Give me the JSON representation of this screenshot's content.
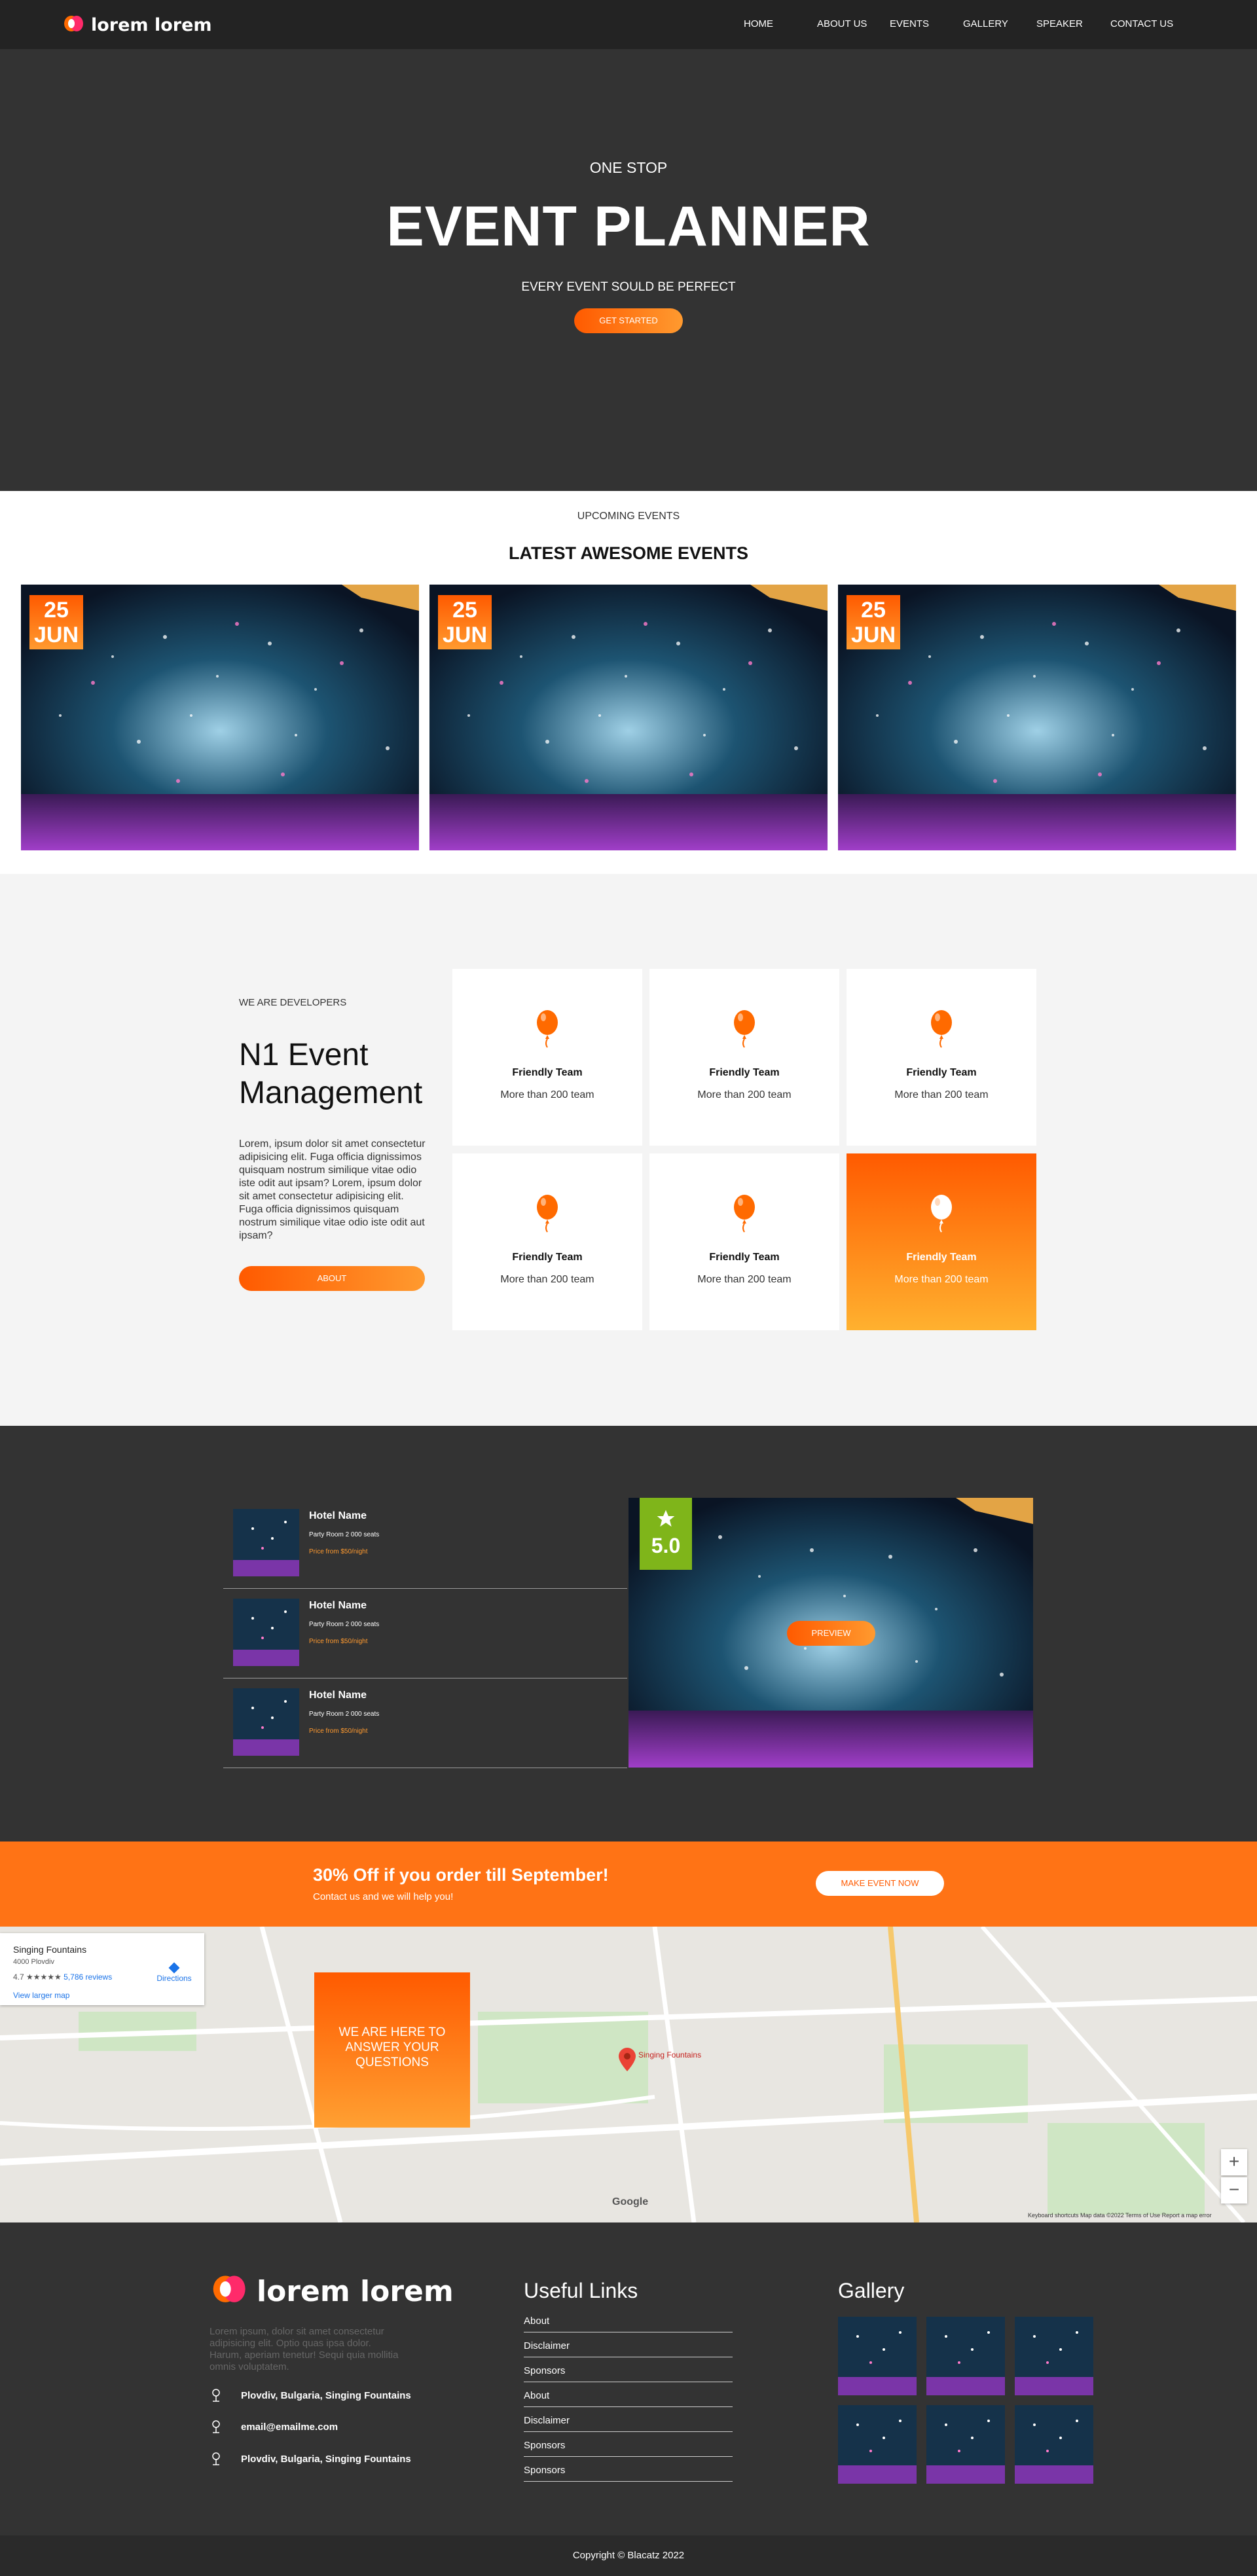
{
  "brand": {
    "name": "lorem lorem"
  },
  "nav": {
    "items": [
      "HOME",
      "ABOUT US",
      "EVENTS",
      "GALLERY",
      "SPEAKER",
      "CONTACT US"
    ]
  },
  "hero": {
    "kicker": "ONE STOP",
    "title": "EVENT PLANNER",
    "subtitle": "EVERY EVENT SOULD BE PERFECT",
    "cta": "GET STARTED"
  },
  "upcoming": {
    "kicker": "UPCOMING EVENTS",
    "title": "LATEST AWESOME EVENTS",
    "events": [
      {
        "day": "25",
        "month": "JUN"
      },
      {
        "day": "25",
        "month": "JUN"
      },
      {
        "day": "25",
        "month": "JUN"
      }
    ]
  },
  "developers": {
    "kicker": "WE ARE DEVELOPERS",
    "title": "N1 Event Management",
    "text": "Lorem, ipsum dolor sit amet consectetur adipisicing elit. Fuga officia dignissimos quisquam nostrum similique vitae odio iste odit aut ipsam? Lorem, ipsum dolor sit amet consectetur adipisicing elit. Fuga officia dignissimos quisquam nostrum similique vitae odio iste odit aut ipsam?",
    "button": "ABOUT",
    "features": [
      {
        "title": "Friendly Team",
        "subtitle": "More than 200 team"
      },
      {
        "title": "Friendly Team",
        "subtitle": "More than 200 team"
      },
      {
        "title": "Friendly Team",
        "subtitle": "More than 200 team"
      },
      {
        "title": "Friendly Team",
        "subtitle": "More than 200 team"
      },
      {
        "title": "Friendly Team",
        "subtitle": "More than 200 team"
      },
      {
        "title": "Friendly Team",
        "subtitle": "More than 200 team"
      }
    ]
  },
  "hotels": {
    "items": [
      {
        "name": "Hotel Name",
        "desc": "Party Room 2 000 seats",
        "price": "Price from $50/night"
      },
      {
        "name": "Hotel Name",
        "desc": "Party Room 2 000 seats",
        "price": "Price from $50/night"
      },
      {
        "name": "Hotel Name",
        "desc": "Party Room 2 000 seats",
        "price": "Price from $50/night"
      }
    ],
    "rating": "5.0",
    "preview": "PREVIEW"
  },
  "promo": {
    "title": "30% Off if you order till September!",
    "subtitle": "Contact us and we will help you!",
    "button": "MAKE EVENT NOW"
  },
  "map": {
    "place": "Singing Fountains",
    "address": "4000 Plovdiv",
    "rating": "4.7 ★★★★★",
    "reviews": "5,786 reviews",
    "larger": "View larger map",
    "directions": "Directions",
    "answer": "WE ARE HERE TO ANSWER YOUR QUESTIONS",
    "google": "Google",
    "footer_text": "Keyboard shortcuts   Map data ©2022   Terms of Use   Report a map error",
    "pin_label": "Singing Fountains",
    "zoom_in": "+",
    "zoom_out": "−"
  },
  "footer": {
    "about": "Lorem ipsum, dolor sit amet consectetur adipisicing elit. Optio quas ipsa dolor. Harum, aperiam tenetur! Sequi quia mollitia omnis voluptatem.",
    "contacts": [
      "Plovdiv, Bulgaria, Singing Fountains",
      "email@emailme.com",
      "Plovdiv, Bulgaria, Singing Fountains"
    ],
    "links_heading": "Useful Links",
    "links": [
      "About",
      "Disclaimer",
      "Sponsors",
      "About",
      "Disclaimer",
      "Sponsors",
      "Sponsors"
    ],
    "gallery_heading": "Gallery"
  },
  "copyright": "Copyright © Blacatz 2022",
  "colors": {
    "accent": "#ff7315",
    "dark": "#333333",
    "rating": "#7fb51a"
  }
}
